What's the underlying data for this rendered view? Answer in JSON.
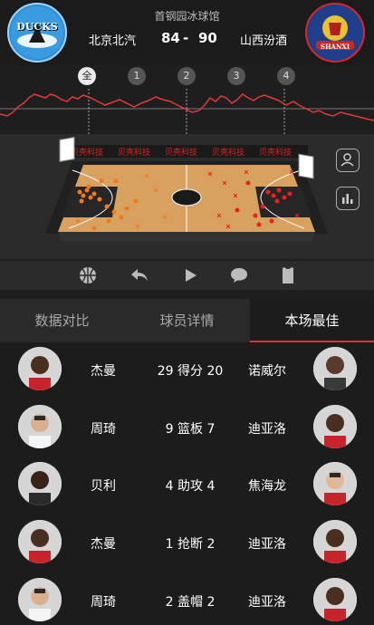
{
  "header": {
    "venue": "首钢园冰球馆",
    "home_team": "北京北汽",
    "away_team": "山西汾酒",
    "home_score": "84",
    "score_sep": "-",
    "away_score": "90",
    "home_logo_text": "DUCKS",
    "away_logo_text": "SHANXI"
  },
  "periods": [
    "全",
    "1",
    "2",
    "3",
    "4"
  ],
  "court": {
    "sponsor": "贝壳科技"
  },
  "controls": [
    "basketball-icon",
    "undo-icon",
    "play-icon",
    "comment-icon",
    "jersey-icon"
  ],
  "tabs": [
    "数据对比",
    "球员详情",
    "本场最佳"
  ],
  "best": [
    {
      "left_name": "杰曼",
      "left_value": "29",
      "stat": "得分",
      "right_value": "20",
      "right_name": "诺威尔"
    },
    {
      "left_name": "周琦",
      "left_value": "9",
      "stat": "篮板",
      "right_value": "7",
      "right_name": "迪亚洛"
    },
    {
      "left_name": "贝利",
      "left_value": "4",
      "stat": "助攻",
      "right_value": "4",
      "right_name": "焦海龙"
    },
    {
      "left_name": "杰曼",
      "left_value": "1",
      "stat": "抢断",
      "right_value": "2",
      "right_name": "迪亚洛"
    },
    {
      "left_name": "周琦",
      "left_value": "2",
      "stat": "盖帽",
      "right_value": "2",
      "right_name": "迪亚洛"
    }
  ],
  "colors": {
    "accent": "#e03030",
    "flow_line": "#e03b3b",
    "court_wood": "#d9a15f"
  }
}
